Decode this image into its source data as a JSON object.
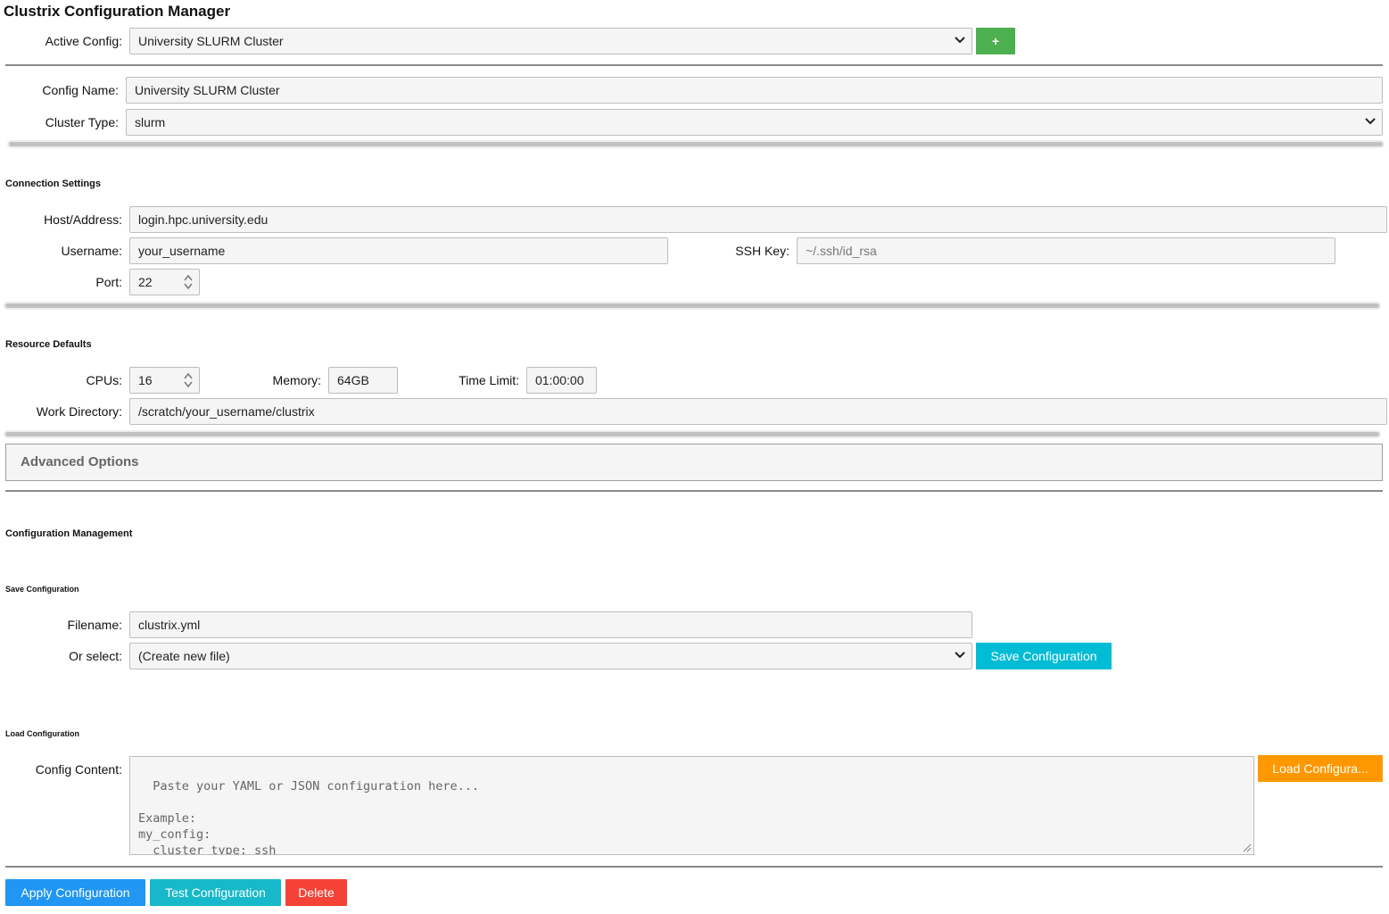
{
  "app": {
    "title": "Clustrix Configuration Manager"
  },
  "active_config": {
    "label": "Active Config:",
    "value": "University SLURM Cluster",
    "add_label": "+"
  },
  "general": {
    "config_name_label": "Config Name:",
    "config_name_value": "University SLURM Cluster",
    "cluster_type_label": "Cluster Type:",
    "cluster_type_value": "slurm"
  },
  "connection": {
    "heading": "Connection Settings",
    "host_label": "Host/Address:",
    "host_value": "login.hpc.university.edu",
    "username_label": "Username:",
    "username_value": "your_username",
    "ssh_key_label": "SSH Key:",
    "ssh_key_placeholder": "~/.ssh/id_rsa",
    "port_label": "Port:",
    "port_value": "22"
  },
  "resources": {
    "heading": "Resource Defaults",
    "cpus_label": "CPUs:",
    "cpus_value": "16",
    "memory_label": "Memory:",
    "memory_value": "64GB",
    "time_limit_label": "Time Limit:",
    "time_limit_value": "01:00:00",
    "workdir_label": "Work Directory:",
    "workdir_value": "/scratch/your_username/clustrix"
  },
  "advanced": {
    "label": "Advanced Options"
  },
  "management": {
    "heading": "Configuration Management",
    "save": {
      "heading": "Save Configuration",
      "filename_label": "Filename:",
      "filename_value": "clustrix.yml",
      "select_label": "Or select:",
      "select_value": "(Create new file)",
      "button_label": "Save Configuration"
    },
    "load": {
      "heading": "Load Configuration",
      "content_label": "Config Content:",
      "placeholder": "Paste your YAML or JSON configuration here...\n\nExample:\nmy_config:\n  cluster_type: ssh\n  cluster_host: myserver.com",
      "button_label": "Load Configura..."
    }
  },
  "actions": {
    "apply_label": "Apply Configuration",
    "test_label": "Test Configuration",
    "delete_label": "Delete"
  },
  "colors": {
    "green": "#4caf50",
    "cyan": "#00bcd4",
    "orange": "#ff9800",
    "blue": "#2196f3",
    "teal": "#17b8c9",
    "red": "#f44336"
  },
  "icons": {
    "dropdown": "chevron-down-icon",
    "spinner": "spinner-arrows-icon",
    "resize": "resize-grip-icon"
  }
}
